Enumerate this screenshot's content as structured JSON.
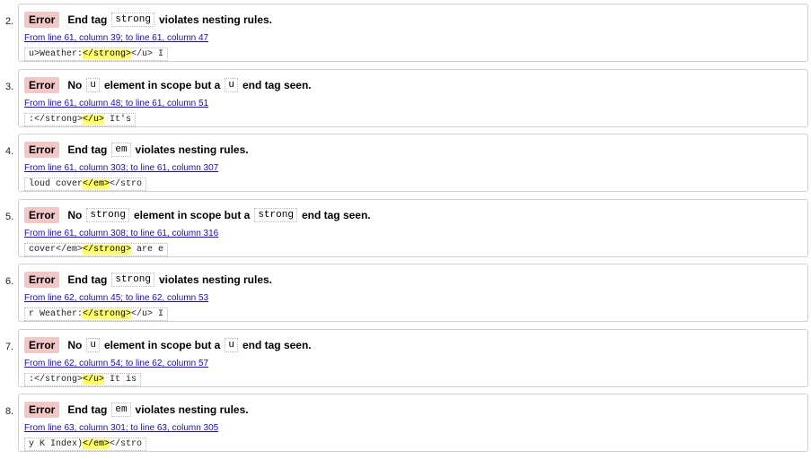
{
  "errors": [
    {
      "number": "2.",
      "severity": "Error",
      "message": [
        {
          "t": "End tag"
        },
        {
          "t": "strong",
          "code": true
        },
        {
          "t": "violates nesting rules."
        }
      ],
      "location": "From line 61, column 39; to line 61, column 47",
      "extract": {
        "pre": "u>Weather:",
        "hl": "</strong>",
        "post": "</u> I"
      }
    },
    {
      "number": "3.",
      "severity": "Error",
      "message": [
        {
          "t": "No"
        },
        {
          "t": "u",
          "code": true
        },
        {
          "t": "element in scope but a"
        },
        {
          "t": "u",
          "code": true
        },
        {
          "t": "end tag seen."
        }
      ],
      "location": "From line 61, column 48; to line 61, column 51",
      "extract": {
        "pre": ":</strong>",
        "hl": "</u>",
        "post": " It's"
      }
    },
    {
      "number": "4.",
      "severity": "Error",
      "message": [
        {
          "t": "End tag"
        },
        {
          "t": "em",
          "code": true
        },
        {
          "t": "violates nesting rules."
        }
      ],
      "location": "From line 61, column 303; to line 61, column 307",
      "extract": {
        "pre": "loud cover",
        "hl": "</em>",
        "post": "</stro"
      }
    },
    {
      "number": "5.",
      "severity": "Error",
      "message": [
        {
          "t": "No"
        },
        {
          "t": "strong",
          "code": true
        },
        {
          "t": "element in scope but a"
        },
        {
          "t": "strong",
          "code": true
        },
        {
          "t": "end tag seen."
        }
      ],
      "location": "From line 61, column 308; to line 61, column 316",
      "extract": {
        "pre": "cover</em>",
        "hl": "</strong>",
        "post": " are e"
      }
    },
    {
      "number": "6.",
      "severity": "Error",
      "message": [
        {
          "t": "End tag"
        },
        {
          "t": "strong",
          "code": true
        },
        {
          "t": "violates nesting rules."
        }
      ],
      "location": "From line 62, column 45; to line 62, column 53",
      "extract": {
        "pre": "r Weather:",
        "hl": "</strong>",
        "post": "</u> I"
      }
    },
    {
      "number": "7.",
      "severity": "Error",
      "message": [
        {
          "t": "No"
        },
        {
          "t": "u",
          "code": true
        },
        {
          "t": "element in scope but a"
        },
        {
          "t": "u",
          "code": true
        },
        {
          "t": "end tag seen."
        }
      ],
      "location": "From line 62, column 54; to line 62, column 57",
      "extract": {
        "pre": ":</strong>",
        "hl": "</u>",
        "post": " It is"
      }
    },
    {
      "number": "8.",
      "severity": "Error",
      "message": [
        {
          "t": "End tag"
        },
        {
          "t": "em",
          "code": true
        },
        {
          "t": "violates nesting rules."
        }
      ],
      "location": "From line 63, column 301; to line 63, column 305",
      "extract": {
        "pre": "y K Index)",
        "hl": "</em>",
        "post": "</stro"
      }
    }
  ],
  "colors": {
    "badge_bg": "#f4c7c7",
    "highlight": "#ffff66",
    "link": "#1a0dab",
    "border": "#cfcfcf"
  }
}
